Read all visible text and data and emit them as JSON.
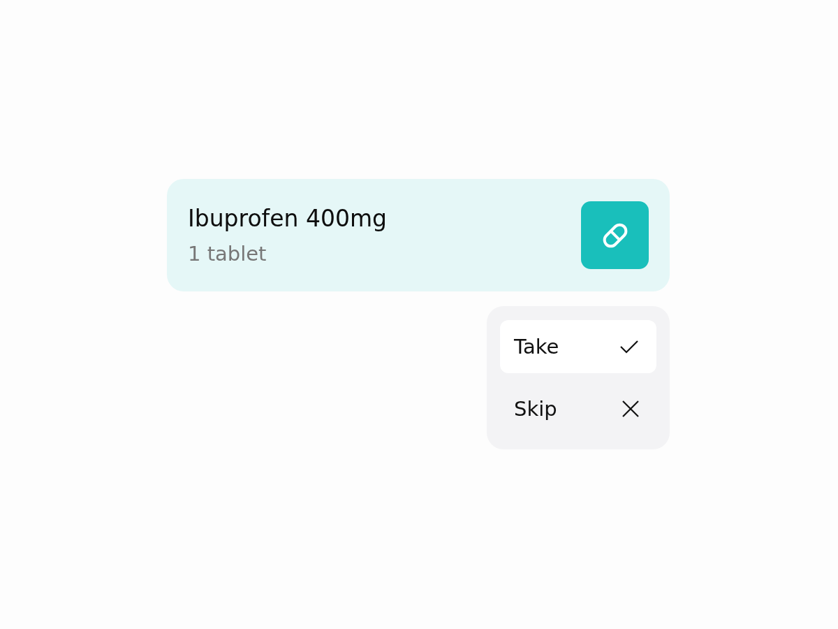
{
  "card": {
    "title": "Ibuprofen 400mg",
    "subtitle": "1 tablet"
  },
  "menu": {
    "items": [
      {
        "label": "Take",
        "kind": "check",
        "selected": true
      },
      {
        "label": "Skip",
        "kind": "cross",
        "selected": false
      }
    ]
  }
}
